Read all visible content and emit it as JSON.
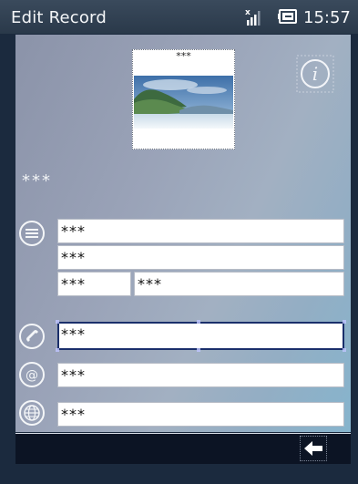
{
  "title_bar": {
    "title": "Edit Record",
    "time": "15:57"
  },
  "photo": {
    "caption": "***"
  },
  "record": {
    "name": "***"
  },
  "address": {
    "line1": "***",
    "line2": "***",
    "city": "***",
    "zip": "***"
  },
  "phone": {
    "value": "***"
  },
  "email": {
    "value": "***"
  },
  "web": {
    "value": "***"
  },
  "icons": {
    "signal": "signal-strength-icon",
    "battery": "battery-charging-icon",
    "info": "info-icon",
    "address": "address-list-icon",
    "phone": "phone-icon",
    "email": "at-sign-icon",
    "web": "globe-icon",
    "back": "back-arrow-icon"
  },
  "colors": {
    "title_bar": "#2f3f51",
    "focus_border": "#1a2f6b",
    "bottom_bar": "#0c1424"
  }
}
